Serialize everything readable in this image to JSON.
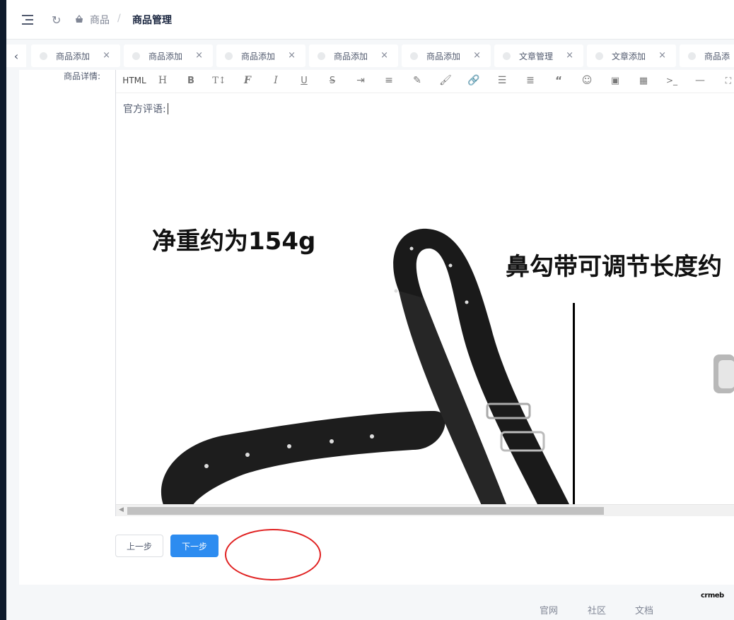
{
  "header": {
    "breadcrumb": [
      "商品",
      "商品管理"
    ],
    "separator": "/"
  },
  "tabs": [
    {
      "label": "商品添加"
    },
    {
      "label": "商品添加"
    },
    {
      "label": "商品添加"
    },
    {
      "label": "商品添加"
    },
    {
      "label": "商品添加"
    },
    {
      "label": "文章管理"
    },
    {
      "label": "文章添加"
    },
    {
      "label": "商品添"
    }
  ],
  "form": {
    "detail_label": "商品详情:"
  },
  "editor": {
    "toolbar_html": "HTML",
    "toolbar_tools": [
      "heading-icon",
      "bold-icon",
      "font-size-icon",
      "font-family-icon",
      "italic-icon",
      "underline-icon",
      "strikethrough-icon",
      "indent-icon",
      "line-height-icon",
      "highlight-icon",
      "brush-icon",
      "link-icon",
      "list-icon",
      "align-icon",
      "quote-icon",
      "emoji-icon",
      "image-icon",
      "video-icon",
      "code-icon",
      "divider-icon",
      "fullscreen-icon"
    ],
    "content_text": "官方评语:",
    "image_caption_left": "净重约为154g",
    "image_caption_right": "鼻勾带可调节长度约"
  },
  "buttons": {
    "prev": "上一步",
    "next": "下一步"
  },
  "footer": {
    "logo": "crmeb",
    "links": [
      "官网",
      "社区",
      "文档"
    ]
  },
  "colors": {
    "primary": "#2d8cf0",
    "annotation": "#e02020",
    "sidebar": "#0e1a2b"
  }
}
